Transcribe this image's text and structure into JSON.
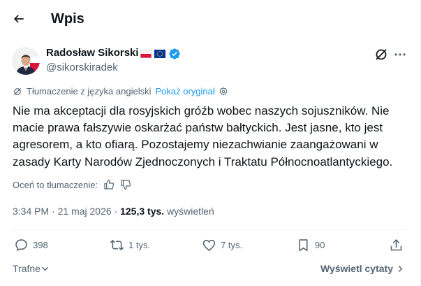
{
  "header": {
    "title": "Wpis"
  },
  "author": {
    "name": "Radosław Sikorski",
    "handle": "@sikorskiradek"
  },
  "translation": {
    "label": "Tłumaczenie z języka angielski",
    "show_original": "Pokaż oryginał"
  },
  "post": {
    "text": "Nie ma akceptacji dla rosyjskich gróźb wobec naszych sojuszników. Nie macie prawa fałszywie oskarżać państw bałtyckich. Jest jasne, kto jest agresorem, a kto ofiarą. Pozostajemy niezachwianie zaangażowani w zasady Karty Narodów Zjednoczonych i Traktatu Północnoatlantyckiego."
  },
  "rating": {
    "label": "Oceń to tłumaczenie:"
  },
  "meta": {
    "time": "3:34 PM",
    "sep": "·",
    "date": "21 maj 2026",
    "views_count": "125,3 tys.",
    "views_label": "wyświetleń"
  },
  "actions": {
    "replies": "398",
    "reposts": "1 tys.",
    "likes": "7 tys.",
    "bookmarks": "90"
  },
  "bottom": {
    "sort_label": "Trafne",
    "quotes_label": "Wyświetl cytaty"
  },
  "colors": {
    "accent": "#1d9bf0",
    "text": "#0f1419",
    "muted": "#536471",
    "divider": "#eff3f4",
    "verified": "#1d9bf0"
  },
  "icons": {
    "back": "arrow-left-icon",
    "grok": "grok-icon",
    "more": "more-horizontal-icon",
    "translate": "translate-icon",
    "gear": "gear-icon",
    "thumb_up": "thumb-up-icon",
    "thumb_down": "thumb-down-icon",
    "reply": "reply-icon",
    "repost": "repost-icon",
    "like": "heart-icon",
    "bookmark": "bookmark-icon",
    "share": "share-icon",
    "verified": "verified-badge-icon",
    "flag_pl": "poland-flag-icon",
    "flag_eu": "eu-flag-icon"
  }
}
